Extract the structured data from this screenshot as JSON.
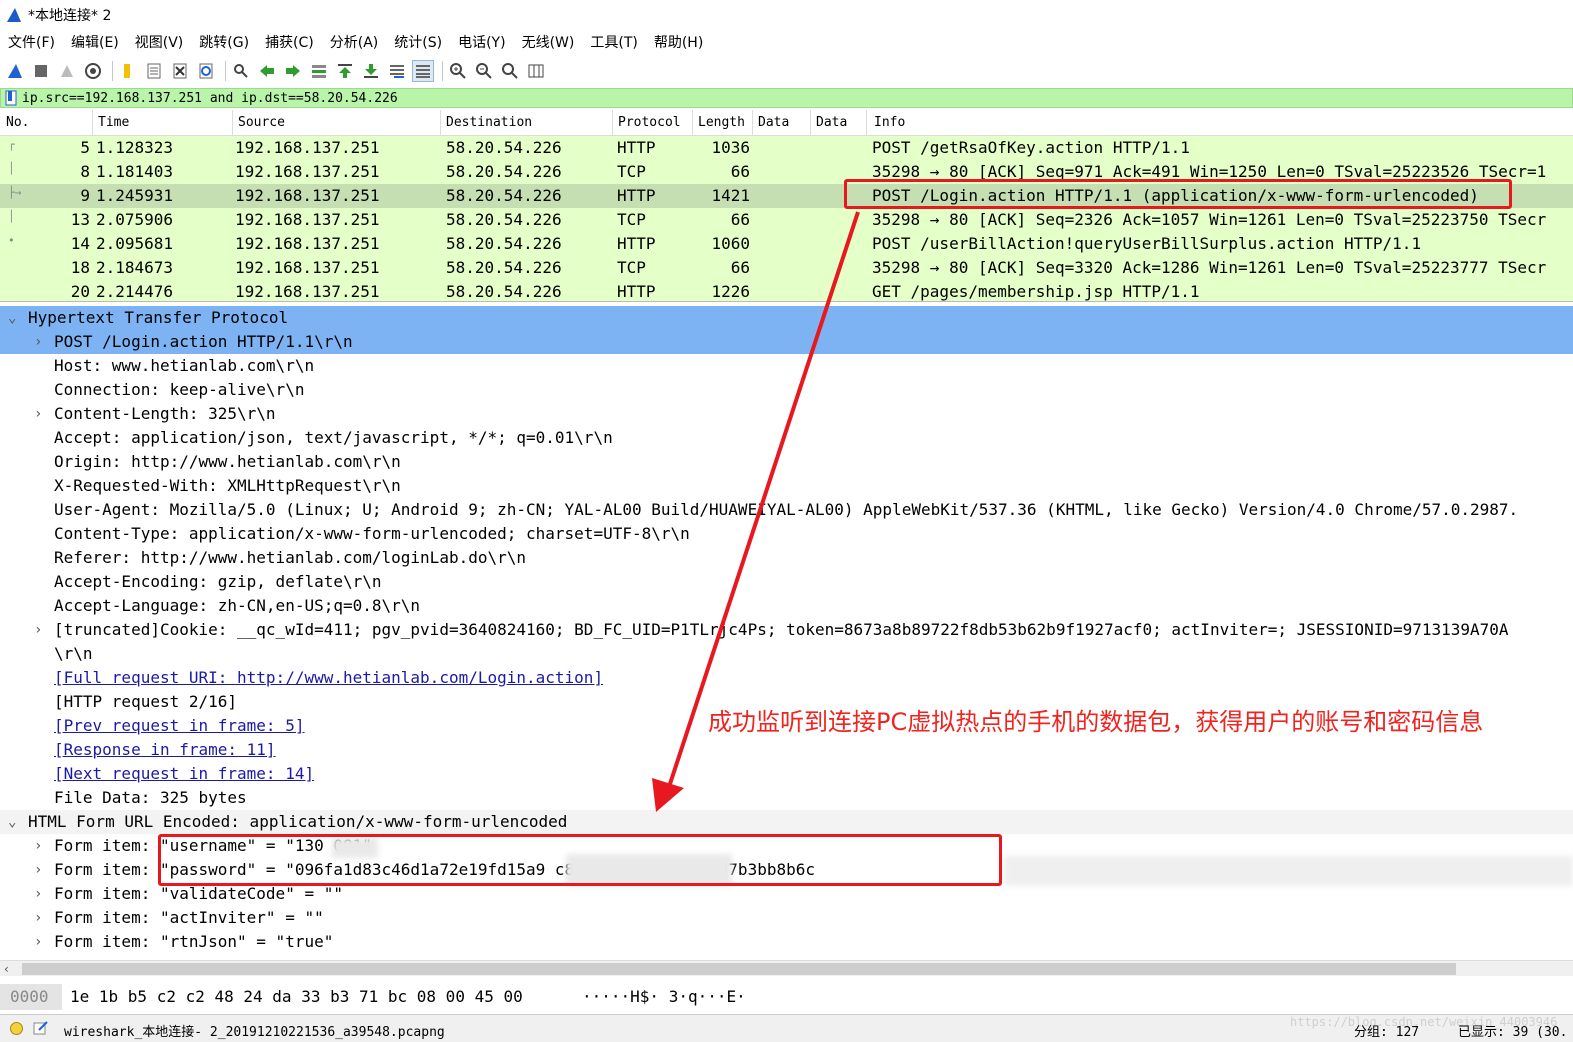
{
  "window": {
    "title": "*本地连接* 2"
  },
  "menu": [
    "文件(F)",
    "编辑(E)",
    "视图(V)",
    "跳转(G)",
    "捕获(C)",
    "分析(A)",
    "统计(S)",
    "电话(Y)",
    "无线(W)",
    "工具(T)",
    "帮助(H)"
  ],
  "toolbar": {
    "icons": [
      "shark-fin-start-icon",
      "stop-icon",
      "restart-icon",
      "options-gear-icon",
      "open-folder-icon",
      "save-file-icon",
      "close-file-icon",
      "reload-icon",
      "find-icon",
      "back-arrow-icon",
      "forward-arrow-icon",
      "go-to-packet-icon",
      "first-packet-icon",
      "last-packet-icon",
      "auto-scroll-icon",
      "colorize-icon",
      "zoom-in-icon",
      "zoom-out-icon",
      "normal-size-icon",
      "resize-columns-icon"
    ]
  },
  "filter": {
    "value": "ip.src==192.168.137.251 and ip.dst==58.20.54.226"
  },
  "packet_list": {
    "columns": [
      "No.",
      "Time",
      "Source",
      "Destination",
      "Protocol",
      "Length",
      "Data",
      "Data",
      "Info"
    ],
    "rows": [
      {
        "no": "5",
        "time": "1.128323",
        "src": "192.168.137.251",
        "dst": "58.20.54.226",
        "proto": "HTTP",
        "len": "1036",
        "info": "POST /getRsaOfKey.action HTTP/1.1"
      },
      {
        "no": "8",
        "time": "1.181403",
        "src": "192.168.137.251",
        "dst": "58.20.54.226",
        "proto": "TCP",
        "len": "66",
        "info": "35298 → 80 [ACK] Seq=971 Ack=491 Win=1250 Len=0 TSval=25223526 TSecr=1"
      },
      {
        "no": "9",
        "time": "1.245931",
        "src": "192.168.137.251",
        "dst": "58.20.54.226",
        "proto": "HTTP",
        "len": "1421",
        "info": "POST /Login.action HTTP/1.1  (application/x-www-form-urlencoded)"
      },
      {
        "no": "13",
        "time": "2.075906",
        "src": "192.168.137.251",
        "dst": "58.20.54.226",
        "proto": "TCP",
        "len": "66",
        "info": "35298 → 80 [ACK] Seq=2326 Ack=1057 Win=1261 Len=0 TSval=25223750 TSecr"
      },
      {
        "no": "14",
        "time": "2.095681",
        "src": "192.168.137.251",
        "dst": "58.20.54.226",
        "proto": "HTTP",
        "len": "1060",
        "info": "POST /userBillAction!queryUserBillSurplus.action HTTP/1.1"
      },
      {
        "no": "18",
        "time": "2.184673",
        "src": "192.168.137.251",
        "dst": "58.20.54.226",
        "proto": "TCP",
        "len": "66",
        "info": "35298 → 80 [ACK] Seq=3320 Ack=1286 Win=1261 Len=0 TSval=25223777 TSecr"
      },
      {
        "no": "20",
        "time": "2.214476",
        "src": "192.168.137.251",
        "dst": "58.20.54.226",
        "proto": "HTTP",
        "len": "1226",
        "info": "GET /pages/membership.jsp HTTP/1.1"
      }
    ]
  },
  "details": {
    "http_header": "Hypertext Transfer Protocol",
    "lines": [
      {
        "text": "POST /Login.action HTTP/1.1\\r\\n",
        "expander": true,
        "highlight": true
      },
      {
        "text": "Host: www.hetianlab.com\\r\\n"
      },
      {
        "text": "Connection: keep-alive\\r\\n"
      },
      {
        "text": "Content-Length: 325\\r\\n",
        "expander": true
      },
      {
        "text": "Accept: application/json, text/javascript, */*; q=0.01\\r\\n"
      },
      {
        "text": "Origin: http://www.hetianlab.com\\r\\n"
      },
      {
        "text": "X-Requested-With: XMLHttpRequest\\r\\n"
      },
      {
        "text": "User-Agent: Mozilla/5.0 (Linux; U; Android 9; zh-CN; YAL-AL00 Build/HUAWEIYAL-AL00) AppleWebKit/537.36 (KHTML, like Gecko) Version/4.0 Chrome/57.0.2987."
      },
      {
        "text": "Content-Type: application/x-www-form-urlencoded; charset=UTF-8\\r\\n"
      },
      {
        "text": "Referer: http://www.hetianlab.com/loginLab.do\\r\\n"
      },
      {
        "text": "Accept-Encoding: gzip, deflate\\r\\n"
      },
      {
        "text": "Accept-Language: zh-CN,en-US;q=0.8\\r\\n"
      },
      {
        "text": " [truncated]Cookie: __qc_wId=411; pgv_pvid=3640824160; BD_FC_UID=P1TLrjc4Ps; token=8673a8b89722f8db53b62b9f1927acf0; actInviter=; JSESSIONID=9713139A70A",
        "expander": true
      },
      {
        "text": "\\r\\n"
      },
      {
        "text": "[Full request URI: http://www.hetianlab.com/Login.action]",
        "link": true
      },
      {
        "text": "[HTTP request 2/16]"
      },
      {
        "text": "[Prev request in frame: 5]",
        "link": true
      },
      {
        "text": "[Response in frame: 11]",
        "link": true
      },
      {
        "text": "[Next request in frame: 14]",
        "link": true
      },
      {
        "text": "File Data: 325 bytes"
      }
    ],
    "form_header": "HTML Form URL Encoded: application/x-www-form-urlencoded",
    "form_items": [
      "Form item: \"username\" = \"130      081\"",
      "Form item: \"password\" = \"096fa1d83c46d1a72e19fd15a9                c8802f87ad75e6f86d7b3bb8b6c",
      "Form item: \"validateCode\" = \"\"",
      "Form item: \"actInviter\" = \"\"",
      "Form item: \"rtnJson\" = \"true\""
    ]
  },
  "bytes": {
    "offset": "0000",
    "hex": "1e 1b b5 c2 c2 48 24 da  33 b3 71 bc 08 00 45 00",
    "ascii": "·····H$· 3·q···E·"
  },
  "status": {
    "file": "wireshark_本地连接- 2_20191210221536_a39548.pcapng",
    "packets": "分组: 127",
    "displayed": "已显示: 39 (30.",
    "watermark": "https://blog.csdn.net/weixin_44003946"
  },
  "annotation": {
    "text": "成功监听到连接PC虚拟热点的手机的数据包，获得用户的账号和密码信息"
  },
  "colors": {
    "row_bg": "#e4ffc7",
    "selected_row": "#c6dfb2",
    "highlight": "#7db3f3",
    "filter_bg": "#b8f5a8",
    "annotation_red": "#e8191e"
  }
}
